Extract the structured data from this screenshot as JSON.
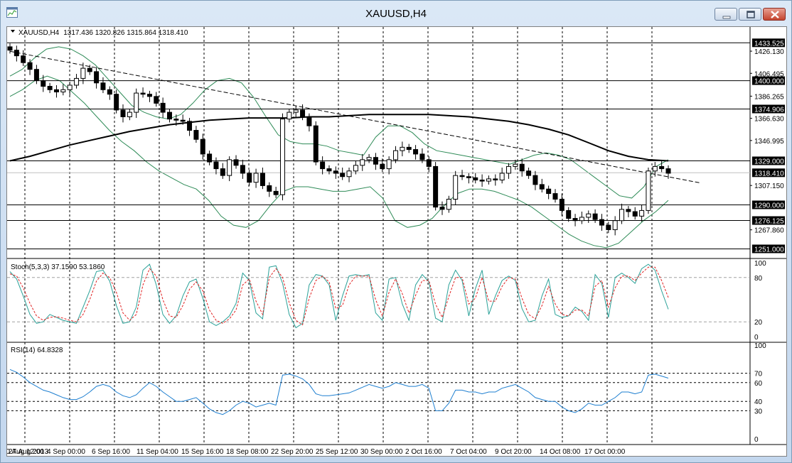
{
  "window": {
    "title": "XAUUSD,H4"
  },
  "info_line": {
    "symbol": "XAUUSD,H4",
    "ohlc": "1317.436 1320.826 1315.864 1318.410"
  },
  "price_labels": [
    "1426.130",
    "1406.495",
    "1386.265",
    "1366.630",
    "1346.995",
    "1307.150",
    "1267.860"
  ],
  "level_labels": [
    "1433.525",
    "1400.000",
    "1374.906",
    "1329.000",
    "1318.410",
    "1290.000",
    "1276.125",
    "1251.000"
  ],
  "stoch": {
    "label": "Stoch(5,3,3) 37.1590 53.1860",
    "scale": [
      "100",
      "80",
      "20",
      "0"
    ]
  },
  "rsi": {
    "label": "RSI(14) 64.8328",
    "scale": [
      "100",
      "70",
      "60",
      "40",
      "30",
      "0"
    ]
  },
  "x_labels": [
    "27 Aug 2013",
    "30 Aug 12:00",
    "4 Sep 00:00",
    "6 Sep 16:00",
    "11 Sep 04:00",
    "15 Sep 16:00",
    "18 Sep 08:00",
    "22 Sep 20:00",
    "25 Sep 12:00",
    "30 Sep 00:00",
    "2 Oct 16:00",
    "7 Oct 04:00",
    "9 Oct 20:00",
    "14 Oct 08:00",
    "17 Oct 00:00"
  ],
  "chart_data": [
    {
      "type": "candlestick",
      "title": "XAUUSD,H4",
      "x_ticks": [
        "27 Aug 2013",
        "30 Aug 12:00",
        "4 Sep 00:00",
        "6 Sep 16:00",
        "11 Sep 04:00",
        "15 Sep 16:00",
        "18 Sep 08:00",
        "22 Sep 20:00",
        "25 Sep 12:00",
        "30 Sep 00:00",
        "2 Oct 16:00",
        "7 Oct 04:00",
        "9 Oct 20:00",
        "14 Oct 08:00",
        "17 Oct 00:00"
      ],
      "ylim": [
        1245,
        1440
      ],
      "last_close": 1318.41,
      "horizontal_levels": [
        1433.525,
        1400.0,
        1374.906,
        1329.0,
        1290.0,
        1276.125,
        1251.0
      ],
      "close_path": [
        1427,
        1422,
        1416,
        1410,
        1400,
        1395,
        1392,
        1390,
        1392,
        1396,
        1402,
        1411,
        1408,
        1398,
        1392,
        1388,
        1374,
        1368,
        1372,
        1389,
        1388,
        1386,
        1380,
        1372,
        1366,
        1365,
        1364,
        1356,
        1348,
        1335,
        1328,
        1322,
        1316,
        1330,
        1325,
        1318,
        1310,
        1318,
        1307,
        1302,
        1299,
        1366,
        1372,
        1374,
        1368,
        1360,
        1328,
        1322,
        1320,
        1318,
        1315,
        1320,
        1325,
        1330,
        1332,
        1326,
        1322,
        1330,
        1338,
        1341,
        1339,
        1335,
        1330,
        1324,
        1288,
        1286,
        1295,
        1316,
        1315,
        1314,
        1312,
        1311,
        1313,
        1312,
        1318,
        1324,
        1326,
        1320,
        1316,
        1308,
        1304,
        1300,
        1295,
        1285,
        1278,
        1276,
        1279,
        1282,
        1277,
        1272,
        1268,
        1276,
        1286,
        1284,
        1280,
        1285,
        1320,
        1324,
        1322,
        1318
      ],
      "moving_average_path": [
        1329,
        1333,
        1338,
        1343,
        1347,
        1351,
        1355,
        1358,
        1361,
        1363,
        1365,
        1366,
        1367,
        1367,
        1367,
        1368,
        1368,
        1369,
        1370,
        1370,
        1370,
        1370,
        1369,
        1368,
        1366,
        1364,
        1361,
        1357,
        1352,
        1345,
        1338,
        1333,
        1330,
        1329
      ],
      "upper_band_path": [
        1404,
        1410,
        1420,
        1428,
        1430,
        1428,
        1422,
        1414,
        1402,
        1390,
        1378,
        1372,
        1368,
        1366,
        1370,
        1380,
        1392,
        1400,
        1402,
        1398,
        1385,
        1368,
        1352,
        1346,
        1344,
        1344,
        1342,
        1338,
        1336,
        1334,
        1350,
        1360,
        1360,
        1354,
        1344,
        1338,
        1336,
        1334,
        1332,
        1330,
        1328,
        1326,
        1330,
        1334,
        1336,
        1334,
        1330,
        1322,
        1314,
        1306,
        1298,
        1296,
        1306,
        1324,
        1330
      ],
      "lower_band_path": [
        1386,
        1392,
        1400,
        1404,
        1400,
        1390,
        1380,
        1368,
        1356,
        1346,
        1338,
        1328,
        1320,
        1314,
        1308,
        1304,
        1294,
        1280,
        1272,
        1270,
        1276,
        1290,
        1302,
        1306,
        1306,
        1304,
        1302,
        1302,
        1304,
        1306,
        1296,
        1276,
        1270,
        1272,
        1278,
        1290,
        1300,
        1304,
        1304,
        1302,
        1298,
        1294,
        1288,
        1280,
        1272,
        1264,
        1258,
        1254,
        1252,
        1256,
        1266,
        1276,
        1284,
        1294
      ],
      "trendline": [
        [
          0,
          1426
        ],
        [
          100,
          1302
        ]
      ]
    },
    {
      "type": "line",
      "title": "Stoch(5,3,3) 37.1590 53.1860",
      "ylim": [
        0,
        100
      ],
      "levels": [
        80,
        20
      ],
      "series": [
        {
          "name": "",
          "values": [
            88,
            78,
            55,
            30,
            18,
            20,
            30,
            26,
            22,
            20,
            18,
            40,
            62,
            88,
            90,
            75,
            42,
            18,
            20,
            40,
            90,
            98,
            70,
            30,
            18,
            28,
            55,
            74,
            78,
            52,
            20,
            15,
            20,
            28,
            45,
            86,
            76,
            32,
            24,
            94,
            96,
            72,
            30,
            12,
            18,
            70,
            84,
            82,
            70,
            22,
            55,
            82,
            84,
            82,
            84,
            32,
            22,
            78,
            80,
            44,
            22,
            70,
            84,
            74,
            25,
            20,
            70,
            90,
            76,
            28,
            65,
            90,
            30,
            55,
            76,
            82,
            76,
            38,
            20,
            22,
            55,
            78,
            30,
            26,
            28,
            40,
            34,
            22,
            84,
            72,
            26,
            80,
            86,
            80,
            72,
            92,
            98,
            90,
            62,
            37
          ]
        },
        {
          "name": "",
          "values": [
            85,
            82,
            66,
            45,
            28,
            22,
            26,
            27,
            25,
            22,
            20,
            30,
            50,
            75,
            86,
            80,
            60,
            32,
            22,
            30,
            70,
            92,
            82,
            50,
            28,
            26,
            42,
            64,
            74,
            62,
            36,
            22,
            18,
            24,
            36,
            70,
            78,
            48,
            30,
            80,
            92,
            80,
            46,
            22,
            16,
            52,
            76,
            82,
            74,
            38,
            42,
            70,
            82,
            82,
            82,
            50,
            28,
            60,
            78,
            58,
            32,
            56,
            76,
            76,
            44,
            26,
            54,
            80,
            80,
            44,
            52,
            80,
            48,
            48,
            68,
            80,
            78,
            52,
            30,
            24,
            42,
            68,
            44,
            30,
            28,
            36,
            36,
            28,
            68,
            76,
            40,
            66,
            82,
            82,
            76,
            86,
            94,
            94,
            76,
            53
          ]
        }
      ]
    },
    {
      "type": "line",
      "title": "RSI(14) 64.8328",
      "ylim": [
        0,
        100
      ],
      "levels": [
        70,
        60,
        40,
        30
      ],
      "series": [
        {
          "name": "",
          "values": [
            74,
            71,
            66,
            60,
            56,
            52,
            50,
            47,
            44,
            42,
            42,
            45,
            50,
            56,
            58,
            56,
            50,
            46,
            44,
            47,
            54,
            60,
            56,
            50,
            45,
            40,
            40,
            42,
            44,
            38,
            32,
            28,
            26,
            30,
            36,
            40,
            38,
            34,
            36,
            38,
            36,
            68,
            69,
            67,
            64,
            58,
            48,
            46,
            46,
            47,
            48,
            49,
            52,
            55,
            58,
            56,
            54,
            56,
            60,
            58,
            56,
            56,
            58,
            54,
            30,
            30,
            38,
            52,
            52,
            50,
            50,
            48,
            50,
            50,
            54,
            56,
            58,
            54,
            50,
            44,
            42,
            40,
            40,
            34,
            30,
            28,
            32,
            38,
            36,
            36,
            40,
            44,
            50,
            50,
            48,
            50,
            68,
            69,
            67,
            64.8
          ]
        }
      ]
    }
  ]
}
